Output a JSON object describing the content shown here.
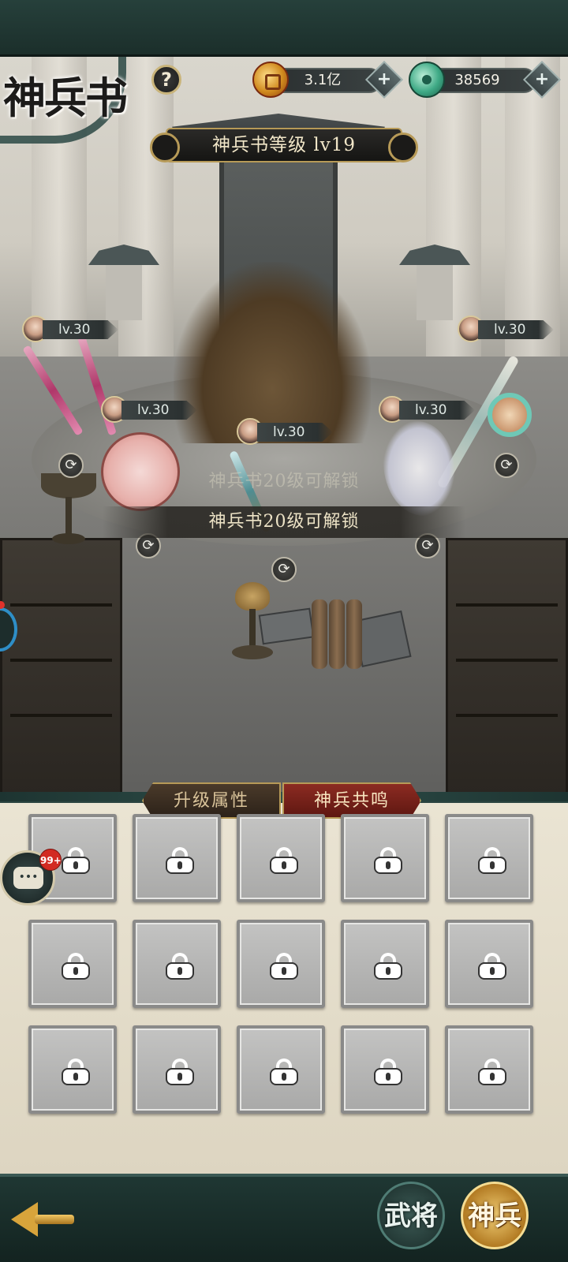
{
  "header": {
    "title": "神兵书",
    "help_label": "?",
    "currencies": [
      {
        "name": "gold",
        "value": "3.1亿",
        "plus": "+"
      },
      {
        "name": "jade",
        "value": "38569",
        "plus": "+"
      }
    ]
  },
  "book_level": {
    "label": "神兵书等级 lv19"
  },
  "heroes": [
    {
      "level": "lv.30"
    },
    {
      "level": "lv.30"
    },
    {
      "level": "lv.30"
    },
    {
      "level": "lv.30"
    },
    {
      "level": "lv.30"
    }
  ],
  "swap_icon": "⟳",
  "unlock": {
    "ghost_text": "神兵书20级可解锁",
    "banner_text": "神兵书20级可解锁"
  },
  "tabs": [
    {
      "label": "升级属性",
      "active": false
    },
    {
      "label": "神兵共鸣",
      "active": true
    }
  ],
  "slots": {
    "count": 15,
    "state": "locked",
    "icon": "lock-icon"
  },
  "chat": {
    "badge": "99+"
  },
  "bottom_nav": {
    "back_icon": "back-arrow-icon",
    "items": [
      {
        "label": "武将"
      },
      {
        "label": "神兵"
      }
    ]
  },
  "colors": {
    "accent_gold": "#b79a57",
    "active_tab": "#8c2b22",
    "panel_bg": "#eae4d3",
    "header_dark": "#1f3733"
  }
}
